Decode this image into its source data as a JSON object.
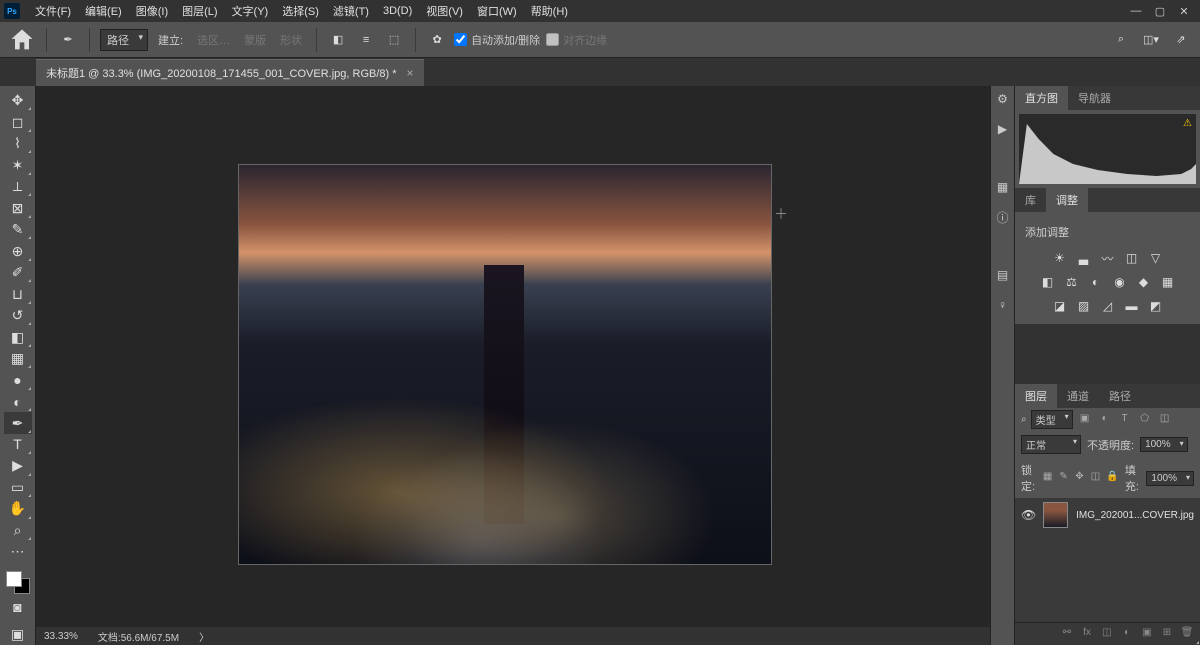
{
  "app": {
    "logo": "Ps"
  },
  "menu": {
    "file": "文件(F)",
    "edit": "编辑(E)",
    "image": "图像(I)",
    "layer": "图层(L)",
    "type": "文字(Y)",
    "select": "选择(S)",
    "filter": "滤镜(T)",
    "threed": "3D(D)",
    "view": "视图(V)",
    "window": "窗口(W)",
    "help": "帮助(H)"
  },
  "windowControls": {
    "minimize": "—",
    "restore": "▢",
    "close": "✕"
  },
  "optionsBar": {
    "pathMode": "路径",
    "build": "建立:",
    "selection": "选区…",
    "mask": "蒙版",
    "shape": "形状",
    "autoAddDelete": "自动添加/删除",
    "alignEdges": "对齐边缘"
  },
  "documentTab": {
    "title": "未标题1 @ 33.3% (IMG_20200108_171455_001_COVER.jpg, RGB/8) *"
  },
  "statusBar": {
    "zoom": "33.33%",
    "docInfo": "文档:56.6M/67.5M"
  },
  "panels": {
    "histogram": {
      "tab": "直方图",
      "navigator": "导航器"
    },
    "library": {
      "tab": "库",
      "adjustments": "调整"
    },
    "addAdjustment": "添加调整",
    "layers": {
      "tab": "图层",
      "channels": "通道",
      "paths": "路径",
      "kind": "类型",
      "blend": "正常",
      "opacity": "不透明度:",
      "opacityValue": "100%",
      "lock": "锁定:",
      "fill": "填充:",
      "fillValue": "100%",
      "layerName": "IMG_202001...COVER.jpg"
    }
  }
}
